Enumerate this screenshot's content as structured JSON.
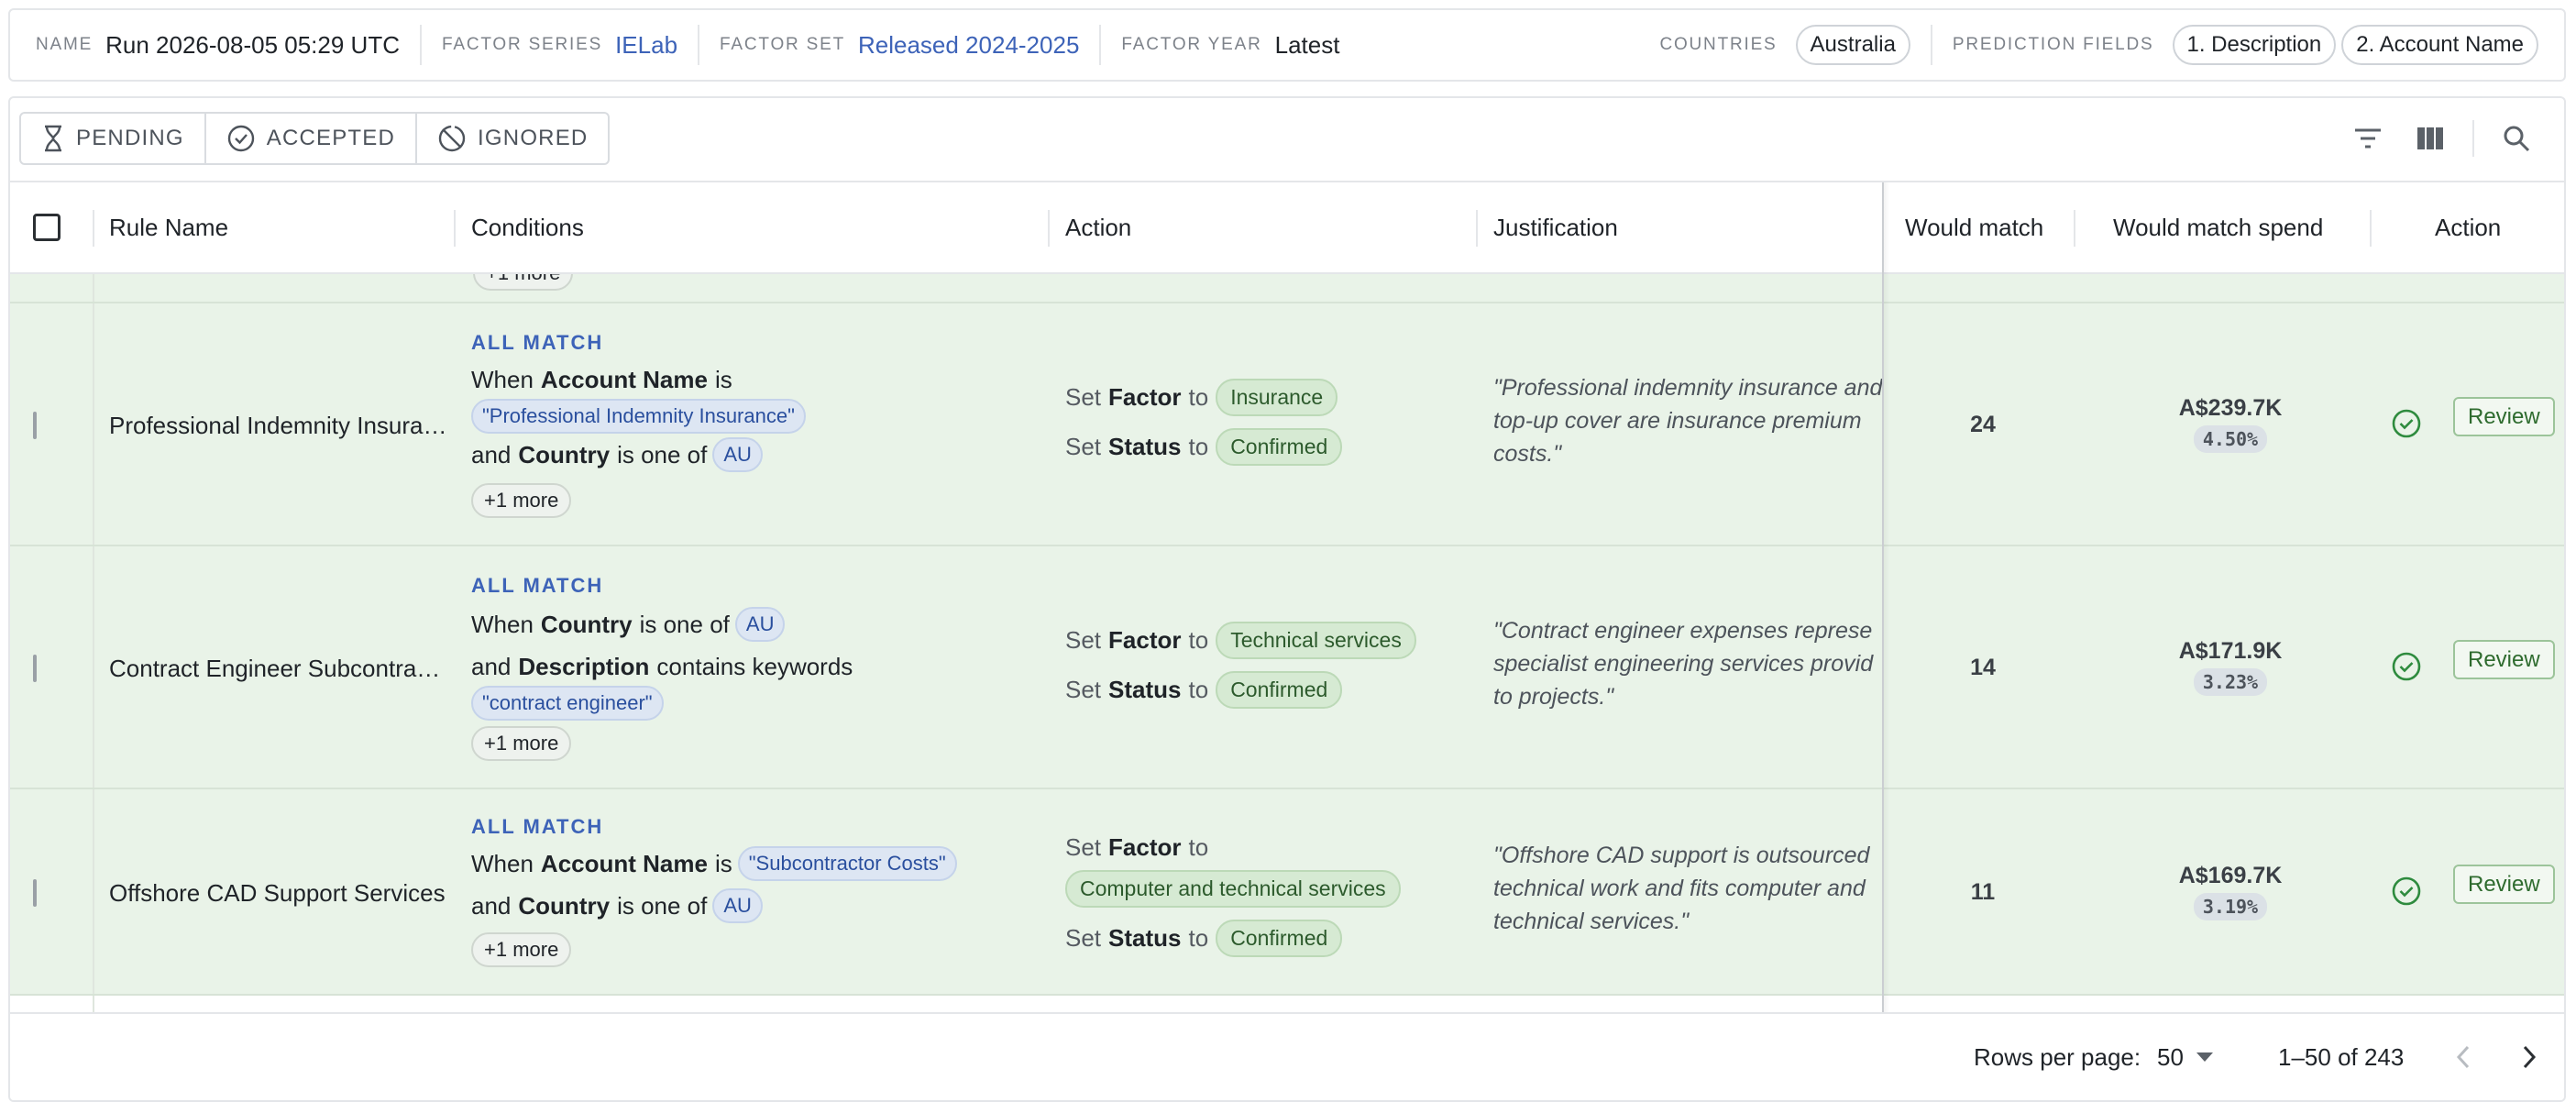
{
  "info_bar": {
    "name_label": "NAME",
    "name_value": "Run 2026-08-05 05:29 UTC",
    "factor_series_label": "FACTOR SERIES",
    "factor_series_value": "IELab",
    "factor_set_label": "FACTOR SET",
    "factor_set_value": "Released 2024-2025",
    "factor_year_label": "FACTOR YEAR",
    "factor_year_value": "Latest",
    "countries_label": "COUNTRIES",
    "countries": [
      "Australia"
    ],
    "prediction_fields_label": "PREDICTION FIELDS",
    "prediction_fields": [
      "1. Description",
      "2. Account Name"
    ]
  },
  "toolbar": {
    "tabs": [
      {
        "label": "PENDING",
        "icon": "hourglass-icon"
      },
      {
        "label": "ACCEPTED",
        "icon": "check-circle-icon"
      },
      {
        "label": "IGNORED",
        "icon": "block-icon"
      }
    ],
    "icons": [
      "filter-icon",
      "columns-icon",
      "search-icon"
    ]
  },
  "table": {
    "columns": {
      "rule_name": "Rule Name",
      "conditions": "Conditions",
      "action": "Action",
      "justification": "Justification",
      "would_match": "Would match",
      "would_match_spend": "Would match spend",
      "action_right": "Action"
    },
    "rows": [
      {
        "rule_name": "Professional Indemnity Insura…",
        "match_type": "ALL MATCH",
        "c1_pre": "When",
        "c1_field": "Account Name",
        "c1_op": "is",
        "c1_value": "\"Professional Indemnity Insurance\"",
        "c2_pre": "and",
        "c2_field": "Country",
        "c2_op": "is one of",
        "c2_value": "AU",
        "more": "+1 more",
        "set_word": "Set",
        "to_word": "to",
        "factor_label": "Factor",
        "factor_value": "Insurance",
        "status_label": "Status",
        "status_value": "Confirmed",
        "just_lines": [
          "\"Professional indemnity insurance and",
          "top-up cover are insurance premium",
          "costs.\""
        ],
        "would_match": "24",
        "spend": "A$239.7K",
        "pct": "4.50%",
        "review": "Review"
      },
      {
        "rule_name": "Contract Engineer Subcontra…",
        "match_type": "ALL MATCH",
        "c1_pre": "When",
        "c1_field": "Country",
        "c1_op": "is one of",
        "c1_value": "AU",
        "c2_pre": "and",
        "c2_field": "Description",
        "c2_op": "contains keywords",
        "c2_value": "\"contract engineer\"",
        "more": "+1 more",
        "set_word": "Set",
        "to_word": "to",
        "factor_label": "Factor",
        "factor_value": "Technical services",
        "status_label": "Status",
        "status_value": "Confirmed",
        "just_lines": [
          "\"Contract engineer expenses represe",
          "specialist engineering services provid",
          "to projects.\""
        ],
        "would_match": "14",
        "spend": "A$171.9K",
        "pct": "3.23%",
        "review": "Review"
      },
      {
        "rule_name": "Offshore CAD Support Services",
        "match_type": "ALL MATCH",
        "c1_pre": "When",
        "c1_field": "Account Name",
        "c1_op": "is",
        "c1_value": "\"Subcontractor Costs\"",
        "c2_pre": "and",
        "c2_field": "Country",
        "c2_op": "is one of",
        "c2_value": "AU",
        "more": "+1 more",
        "set_word": "Set",
        "to_word": "to",
        "factor_label": "Factor",
        "factor_value": "Computer and technical services",
        "status_label": "Status",
        "status_value": "Confirmed",
        "just_lines": [
          "\"Offshore CAD support is outsourced",
          "technical work and fits computer and",
          "technical services.\""
        ],
        "would_match": "11",
        "spend": "A$169.7K",
        "pct": "3.19%",
        "review": "Review"
      }
    ]
  },
  "footer": {
    "rows_per_page_label": "Rows per page:",
    "rows_per_page_value": "50",
    "range": "1–50 of 243"
  },
  "colors": {
    "accent_blue": "#3d63b8",
    "row_green": "#e9f3e8",
    "check_green": "#2e8b3e"
  }
}
